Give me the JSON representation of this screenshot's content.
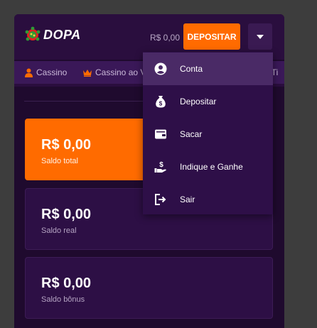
{
  "header": {
    "logo_text": "DOPA",
    "balance": "R$ 0,00",
    "deposit_label": "DEPOSITAR"
  },
  "nav": {
    "items": [
      {
        "label": "Cassino",
        "icon": "user-icon"
      },
      {
        "label": "Cassino ao Vivo",
        "icon": "crown-icon"
      },
      {
        "label": "e Ti",
        "icon": ""
      }
    ]
  },
  "balances": [
    {
      "amount": "R$ 0,00",
      "label": "Saldo total"
    },
    {
      "amount": "R$ 0,00",
      "label": "Saldo real"
    },
    {
      "amount": "R$ 0,00",
      "label": "Saldo bônus"
    }
  ],
  "menu": {
    "items": [
      {
        "label": "Conta",
        "icon": "account-icon"
      },
      {
        "label": "Depositar",
        "icon": "money-bag-icon"
      },
      {
        "label": "Sacar",
        "icon": "wallet-icon"
      },
      {
        "label": "Indique e Ganhe",
        "icon": "hand-money-icon"
      },
      {
        "label": "Sair",
        "icon": "logout-icon"
      }
    ]
  },
  "colors": {
    "accent": "#ff6b00",
    "background": "#1f0a2e",
    "menu_background": "#2e0f48",
    "menu_active": "#4a2a66"
  }
}
